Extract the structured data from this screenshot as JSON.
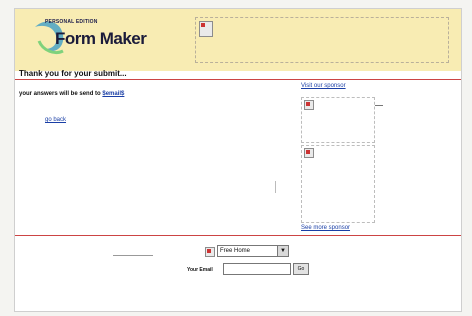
{
  "logo": {
    "edition": "Personal Edition",
    "name": "Form Maker"
  },
  "content": {
    "heading": "Thank you for your submit...",
    "answers_prefix": "your answers will be send to",
    "answers_email": "$email$",
    "go_back": "go back"
  },
  "sidebar": {
    "sponsor_link": "Visit our sponsor",
    "more_link": "See more sponsor"
  },
  "footer": {
    "select_value": "Free Home",
    "email_label": "Your Email",
    "email_value": "",
    "go_label": "Go"
  },
  "colors": {
    "header_bg": "#f8ecb3",
    "rule": "#cc4444",
    "link": "#1a3fa6"
  }
}
